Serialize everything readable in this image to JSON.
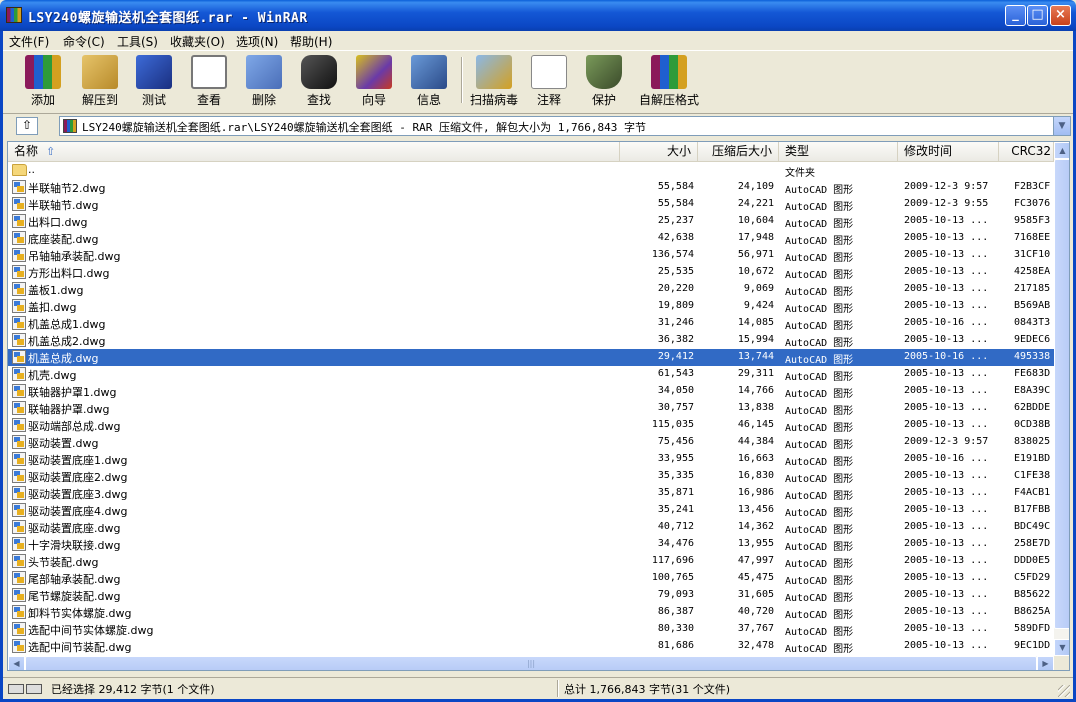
{
  "window": {
    "title": "LSY240螺旋输送机全套图纸.rar - WinRAR",
    "min": "_",
    "max": "□",
    "close": "×"
  },
  "menu": [
    "文件(F)",
    "命令(C)",
    "工具(S)",
    "收藏夹(O)",
    "选项(N)",
    "帮助(H)"
  ],
  "toolbar": [
    {
      "label": "添加",
      "icon": "add-archive-icon"
    },
    {
      "label": "解压到",
      "icon": "extract-to-icon"
    },
    {
      "label": "测试",
      "icon": "test-icon"
    },
    {
      "label": "查看",
      "icon": "view-icon"
    },
    {
      "label": "删除",
      "icon": "delete-icon"
    },
    {
      "label": "查找",
      "icon": "find-icon"
    },
    {
      "label": "向导",
      "icon": "wizard-icon"
    },
    {
      "label": "信息",
      "icon": "info-icon"
    },
    {
      "label": "扫描病毒",
      "icon": "virus-scan-icon"
    },
    {
      "label": "注释",
      "icon": "comment-icon"
    },
    {
      "label": "保护",
      "icon": "protect-icon"
    },
    {
      "label": "自解压格式",
      "icon": "sfx-icon"
    }
  ],
  "address": {
    "up": "⇧",
    "path": "LSY240螺旋输送机全套图纸.rar\\LSY240螺旋输送机全套图纸 - RAR 压缩文件, 解包大小为 1,766,843 字节",
    "drop": "▼"
  },
  "columns": {
    "name": "名称",
    "size": "大小",
    "packed": "压缩后大小",
    "type": "类型",
    "modified": "修改时间",
    "crc": "CRC32",
    "sort": "⇧"
  },
  "parent_row": {
    "name": "..",
    "type": "文件夹"
  },
  "files": [
    {
      "name": "半联轴节2.dwg",
      "size": "55,584",
      "packed": "24,109",
      "type": "AutoCAD 图形",
      "modified": "2009-12-3 9:57",
      "crc": "F2B3CF"
    },
    {
      "name": "半联轴节.dwg",
      "size": "55,584",
      "packed": "24,221",
      "type": "AutoCAD 图形",
      "modified": "2009-12-3 9:55",
      "crc": "FC3076"
    },
    {
      "name": "出料口.dwg",
      "size": "25,237",
      "packed": "10,604",
      "type": "AutoCAD 图形",
      "modified": "2005-10-13 ...",
      "crc": "9585F3"
    },
    {
      "name": "底座装配.dwg",
      "size": "42,638",
      "packed": "17,948",
      "type": "AutoCAD 图形",
      "modified": "2005-10-13 ...",
      "crc": "7168EE"
    },
    {
      "name": "吊轴轴承装配.dwg",
      "size": "136,574",
      "packed": "56,971",
      "type": "AutoCAD 图形",
      "modified": "2005-10-13 ...",
      "crc": "31CF10"
    },
    {
      "name": "方形出料口.dwg",
      "size": "25,535",
      "packed": "10,672",
      "type": "AutoCAD 图形",
      "modified": "2005-10-13 ...",
      "crc": "4258EA"
    },
    {
      "name": "盖板1.dwg",
      "size": "20,220",
      "packed": "9,069",
      "type": "AutoCAD 图形",
      "modified": "2005-10-13 ...",
      "crc": "217185"
    },
    {
      "name": "盖扣.dwg",
      "size": "19,809",
      "packed": "9,424",
      "type": "AutoCAD 图形",
      "modified": "2005-10-13 ...",
      "crc": "B569AB"
    },
    {
      "name": "机盖总成1.dwg",
      "size": "31,246",
      "packed": "14,085",
      "type": "AutoCAD 图形",
      "modified": "2005-10-16 ...",
      "crc": "0843T3"
    },
    {
      "name": "机盖总成2.dwg",
      "size": "36,382",
      "packed": "15,994",
      "type": "AutoCAD 图形",
      "modified": "2005-10-13 ...",
      "crc": "9EDEC6"
    },
    {
      "name": "机盖总成.dwg",
      "size": "29,412",
      "packed": "13,744",
      "type": "AutoCAD 图形",
      "modified": "2005-10-16 ...",
      "crc": "495338",
      "selected": true
    },
    {
      "name": "机壳.dwg",
      "size": "61,543",
      "packed": "29,311",
      "type": "AutoCAD 图形",
      "modified": "2005-10-13 ...",
      "crc": "FE683D"
    },
    {
      "name": "联轴器护罩1.dwg",
      "size": "34,050",
      "packed": "14,766",
      "type": "AutoCAD 图形",
      "modified": "2005-10-13 ...",
      "crc": "E8A39C"
    },
    {
      "name": "联轴器护罩.dwg",
      "size": "30,757",
      "packed": "13,838",
      "type": "AutoCAD 图形",
      "modified": "2005-10-13 ...",
      "crc": "62BDDE"
    },
    {
      "name": "驱动端部总成.dwg",
      "size": "115,035",
      "packed": "46,145",
      "type": "AutoCAD 图形",
      "modified": "2005-10-13 ...",
      "crc": "0CD38B"
    },
    {
      "name": "驱动装置.dwg",
      "size": "75,456",
      "packed": "44,384",
      "type": "AutoCAD 图形",
      "modified": "2009-12-3 9:57",
      "crc": "838025"
    },
    {
      "name": "驱动装置底座1.dwg",
      "size": "33,955",
      "packed": "16,663",
      "type": "AutoCAD 图形",
      "modified": "2005-10-16 ...",
      "crc": "E191BD"
    },
    {
      "name": "驱动装置底座2.dwg",
      "size": "35,335",
      "packed": "16,830",
      "type": "AutoCAD 图形",
      "modified": "2005-10-13 ...",
      "crc": "C1FE38"
    },
    {
      "name": "驱动装置底座3.dwg",
      "size": "35,871",
      "packed": "16,986",
      "type": "AutoCAD 图形",
      "modified": "2005-10-13 ...",
      "crc": "F4ACB1"
    },
    {
      "name": "驱动装置底座4.dwg",
      "size": "35,241",
      "packed": "13,456",
      "type": "AutoCAD 图形",
      "modified": "2005-10-13 ...",
      "crc": "B17FBB"
    },
    {
      "name": "驱动装置底座.dwg",
      "size": "40,712",
      "packed": "14,362",
      "type": "AutoCAD 图形",
      "modified": "2005-10-13 ...",
      "crc": "BDC49C"
    },
    {
      "name": "十字滑块联接.dwg",
      "size": "34,476",
      "packed": "13,955",
      "type": "AutoCAD 图形",
      "modified": "2005-10-13 ...",
      "crc": "258E7D"
    },
    {
      "name": "头节装配.dwg",
      "size": "117,696",
      "packed": "47,997",
      "type": "AutoCAD 图形",
      "modified": "2005-10-13 ...",
      "crc": "DDD0E5"
    },
    {
      "name": "尾部轴承装配.dwg",
      "size": "100,765",
      "packed": "45,475",
      "type": "AutoCAD 图形",
      "modified": "2005-10-13 ...",
      "crc": "C5FD29"
    },
    {
      "name": "尾节螺旋装配.dwg",
      "size": "79,093",
      "packed": "31,605",
      "type": "AutoCAD 图形",
      "modified": "2005-10-13 ...",
      "crc": "B85622"
    },
    {
      "name": "卸料节实体螺旋.dwg",
      "size": "86,387",
      "packed": "40,720",
      "type": "AutoCAD 图形",
      "modified": "2005-10-13 ...",
      "crc": "B8625A"
    },
    {
      "name": "选配中间节实体螺旋.dwg",
      "size": "80,330",
      "packed": "37,767",
      "type": "AutoCAD 图形",
      "modified": "2005-10-13 ...",
      "crc": "589DFD"
    },
    {
      "name": "选配中间节装配.dwg",
      "size": "81,686",
      "packed": "32,478",
      "type": "AutoCAD 图形",
      "modified": "2005-10-13 ...",
      "crc": "9EC1DD"
    }
  ],
  "status": {
    "left": "已经选择 29,412 字节(1 个文件)",
    "right": "总计 1,766,843 字节(31 个文件)"
  },
  "colors": {
    "title_bar": "#0b47c4",
    "selection": "#316ac5",
    "face": "#ece9d8"
  }
}
